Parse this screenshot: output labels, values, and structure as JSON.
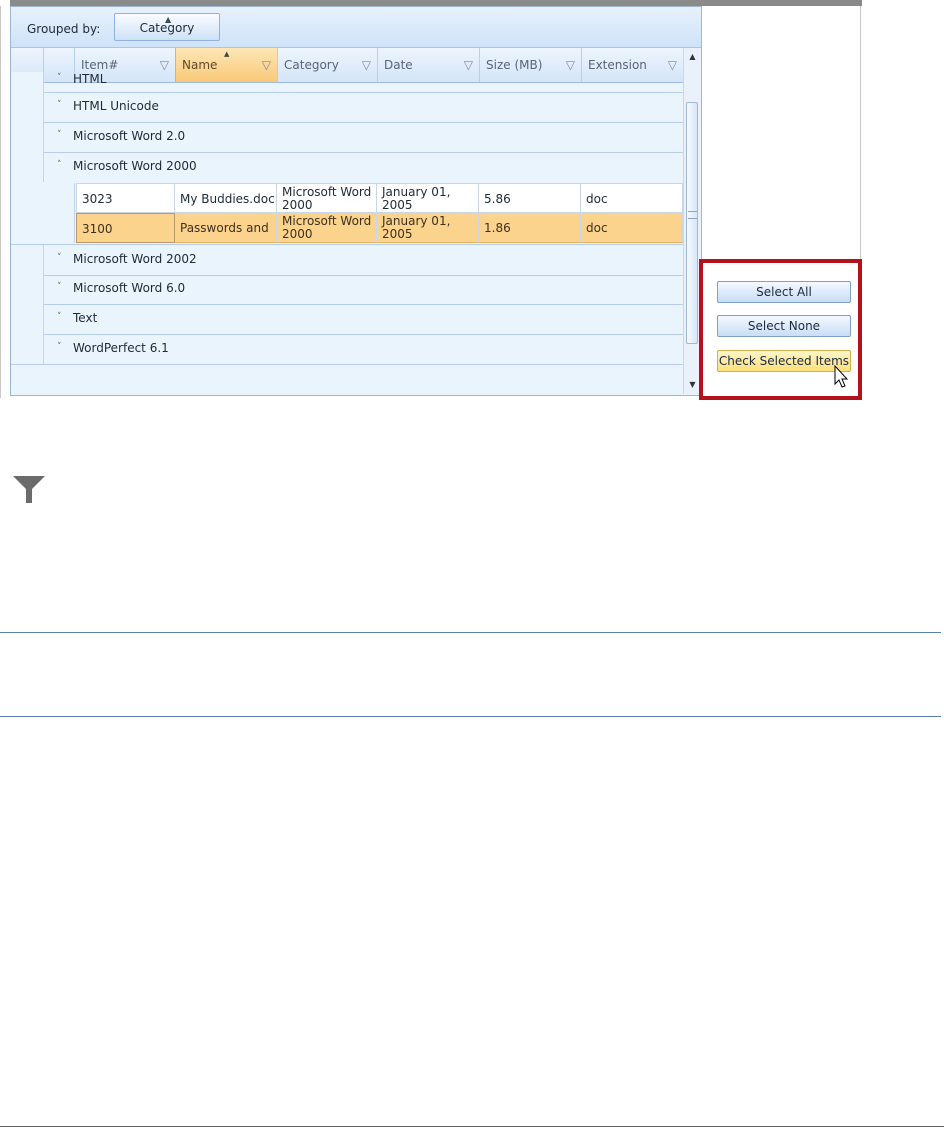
{
  "group_panel": {
    "label": "Grouped by:",
    "chip": "Category"
  },
  "columns": [
    {
      "label": "Item#",
      "sorted": false
    },
    {
      "label": "Name",
      "sorted": true
    },
    {
      "label": "Category",
      "sorted": false
    },
    {
      "label": "Date",
      "sorted": false
    },
    {
      "label": "Size (MB)",
      "sorted": false
    },
    {
      "label": "Extension",
      "sorted": false
    }
  ],
  "groups": [
    {
      "name": "HTML",
      "expanded": false
    },
    {
      "name": "HTML Unicode",
      "expanded": false
    },
    {
      "name": "Microsoft Word 2.0",
      "expanded": false
    },
    {
      "name": "Microsoft Word 2000",
      "expanded": true
    },
    {
      "name": "Microsoft Word 2002",
      "expanded": false
    },
    {
      "name": "Microsoft Word 6.0",
      "expanded": false
    },
    {
      "name": "Text",
      "expanded": false
    },
    {
      "name": "WordPerfect 6.1",
      "expanded": false
    }
  ],
  "rows": [
    {
      "item": "3023",
      "name": "My Buddies.doc",
      "category_line1": "Microsoft Word",
      "category_line2": "2000",
      "date_line1": "January 01,",
      "date_line2": "2005",
      "size": "5.86",
      "extension": "doc",
      "selected": false
    },
    {
      "item": "3100",
      "name": "Passwords and",
      "category_line1": "Microsoft Word",
      "category_line2": "2000",
      "date_line1": "January 01,",
      "date_line2": "2005",
      "size": "1.86",
      "extension": "doc",
      "selected": true
    }
  ],
  "buttons": {
    "select_all": "Select All",
    "select_none": "Select None",
    "check_selected": "Check Selected Items"
  },
  "icons": {
    "column_filter": "filter-icon",
    "large_filter": "filter-icon",
    "expand": "chevron-down-icon",
    "collapse": "chevron-up-icon",
    "cursor": "mouse-cursor-icon"
  },
  "colors": {
    "selection": "#fcd38c",
    "sorted_header": "#f9c978",
    "highlight_frame": "#b3121b",
    "grid_background": "#eaf4fd"
  }
}
